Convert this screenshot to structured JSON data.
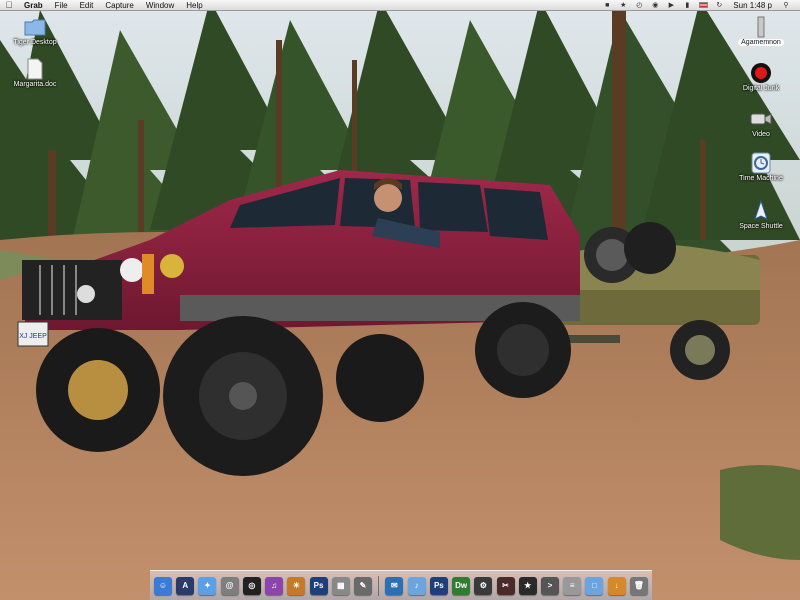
{
  "menubar": {
    "app_name": "Grab",
    "menus": [
      "File",
      "Edit",
      "Capture",
      "Window",
      "Help"
    ],
    "clock": "Sun 1:48 p"
  },
  "desktop_icons": [
    {
      "name": "tiger-desktop",
      "label": "Tiger Desktop",
      "icon": "folder-icon"
    },
    {
      "name": "margarita-doc",
      "label": "Margarita.doc",
      "icon": "document-icon"
    },
    {
      "name": "agamemnon",
      "label": "Agamemnon",
      "icon": "hard-drive-icon"
    },
    {
      "name": "digital-junk",
      "label": "Digital Junk",
      "icon": "red-drive-icon"
    },
    {
      "name": "video",
      "label": "Video",
      "icon": "camera-icon"
    },
    {
      "name": "time-machine",
      "label": "Time Machine",
      "icon": "time-machine-icon"
    },
    {
      "name": "space-shuttle",
      "label": "Space Shuttle",
      "icon": "shuttle-icon"
    }
  ],
  "dock_colors": {
    "finder": "#3a7bd5",
    "dashboard": "#1b1b3a",
    "safari": "#5aa0e8",
    "ichat": "#7cb342",
    "itunes": "#8e44ad",
    "iphoto": "#c47a28",
    "photoshop": "#1f3f7a",
    "preview": "#666",
    "system": "#9aa0a6",
    "dreamweaver": "#2f7d32",
    "folder": "#6aa5e0",
    "trash": "#888"
  },
  "truck_plate": "XJ JEEP"
}
